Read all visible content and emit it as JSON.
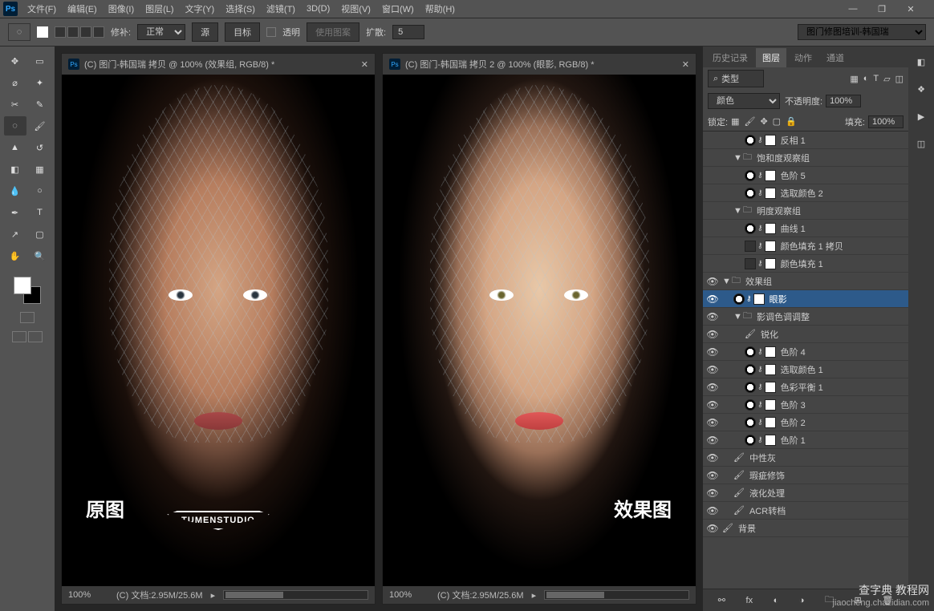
{
  "menu": {
    "file": "文件(F)",
    "edit": "编辑(E)",
    "image": "图像(I)",
    "layer": "图层(L)",
    "type": "文字(Y)",
    "select": "选择(S)",
    "filter": "滤镜(T)",
    "threed": "3D(D)",
    "view": "视图(V)",
    "window": "窗口(W)",
    "help": "帮助(H)"
  },
  "options": {
    "patch_label": "修补:",
    "patch_mode": "正常",
    "source": "源",
    "dest": "目标",
    "transparent": "透明",
    "use_pattern": "使用图案",
    "diffuse_label": "扩散:",
    "diffuse_value": "5",
    "doc_select": "图门修图培训-韩国瑞"
  },
  "documents": {
    "left": {
      "title": "(C) 图门-韩国瑞 拷贝 @ 100% (效果组, RGB/8) *",
      "label": "原图",
      "zoom": "100%",
      "status": "(C) 文档:2.95M/25.6M"
    },
    "right": {
      "title": "(C) 图门-韩国瑞 拷贝 2 @ 100% (眼影, RGB/8) *",
      "label": "效果图",
      "zoom": "100%",
      "status": "(C) 文档:2.95M/25.6M"
    },
    "watermark": "TUMENSTUDIO"
  },
  "panels": {
    "tabs": {
      "history": "历史记录",
      "layers": "图层",
      "actions": "动作",
      "channels": "通道"
    },
    "filter_label": "类型",
    "blend_mode": "颜色",
    "opacity_label": "不透明度:",
    "opacity_value": "100%",
    "lock_label": "锁定:",
    "fill_label": "填充:",
    "fill_value": "100%",
    "search_icon": "⌕"
  },
  "layers": [
    {
      "indent": 2,
      "vis": "",
      "kind": "adj",
      "name": "反相 1"
    },
    {
      "indent": 1,
      "vis": "",
      "kind": "folder",
      "arrow": "▼",
      "name": "饱和度观察组"
    },
    {
      "indent": 2,
      "vis": "",
      "kind": "adj",
      "name": "色阶 5"
    },
    {
      "indent": 2,
      "vis": "",
      "kind": "adj",
      "name": "选取颜色 2"
    },
    {
      "indent": 1,
      "vis": "",
      "kind": "folder",
      "arrow": "▼",
      "name": "明度观察组"
    },
    {
      "indent": 2,
      "vis": "",
      "kind": "adj",
      "name": "曲线 1"
    },
    {
      "indent": 2,
      "vis": "",
      "kind": "solid",
      "name": "颜色填充 1 拷贝"
    },
    {
      "indent": 2,
      "vis": "",
      "kind": "solid",
      "name": "颜色填充 1"
    },
    {
      "indent": 0,
      "vis": "👁",
      "kind": "folder",
      "arrow": "▼",
      "name": "效果组"
    },
    {
      "indent": 1,
      "vis": "👁",
      "kind": "adj",
      "name": "眼影",
      "selected": true
    },
    {
      "indent": 1,
      "vis": "👁",
      "kind": "folder",
      "arrow": "▼",
      "name": "影调色调调整"
    },
    {
      "indent": 2,
      "vis": "👁",
      "kind": "brush",
      "name": "锐化"
    },
    {
      "indent": 2,
      "vis": "👁",
      "kind": "adj",
      "name": "色阶 4"
    },
    {
      "indent": 2,
      "vis": "👁",
      "kind": "adj",
      "name": "选取颜色 1"
    },
    {
      "indent": 2,
      "vis": "👁",
      "kind": "adj",
      "name": "色彩平衡 1"
    },
    {
      "indent": 2,
      "vis": "👁",
      "kind": "adj",
      "name": "色阶 3"
    },
    {
      "indent": 2,
      "vis": "👁",
      "kind": "adj",
      "name": "色阶 2"
    },
    {
      "indent": 2,
      "vis": "👁",
      "kind": "adj",
      "name": "色阶 1"
    },
    {
      "indent": 1,
      "vis": "👁",
      "kind": "brush",
      "name": "中性灰"
    },
    {
      "indent": 1,
      "vis": "👁",
      "kind": "brush",
      "name": "瑕疵修饰"
    },
    {
      "indent": 1,
      "vis": "👁",
      "kind": "brush",
      "name": "液化处理"
    },
    {
      "indent": 1,
      "vis": "👁",
      "kind": "brush",
      "name": "ACR转档"
    },
    {
      "indent": 0,
      "vis": "👁",
      "kind": "brush",
      "name": "背景"
    }
  ],
  "site": {
    "name": "查字典 教程网",
    "url": "jiaocheng.chazidian.com"
  }
}
